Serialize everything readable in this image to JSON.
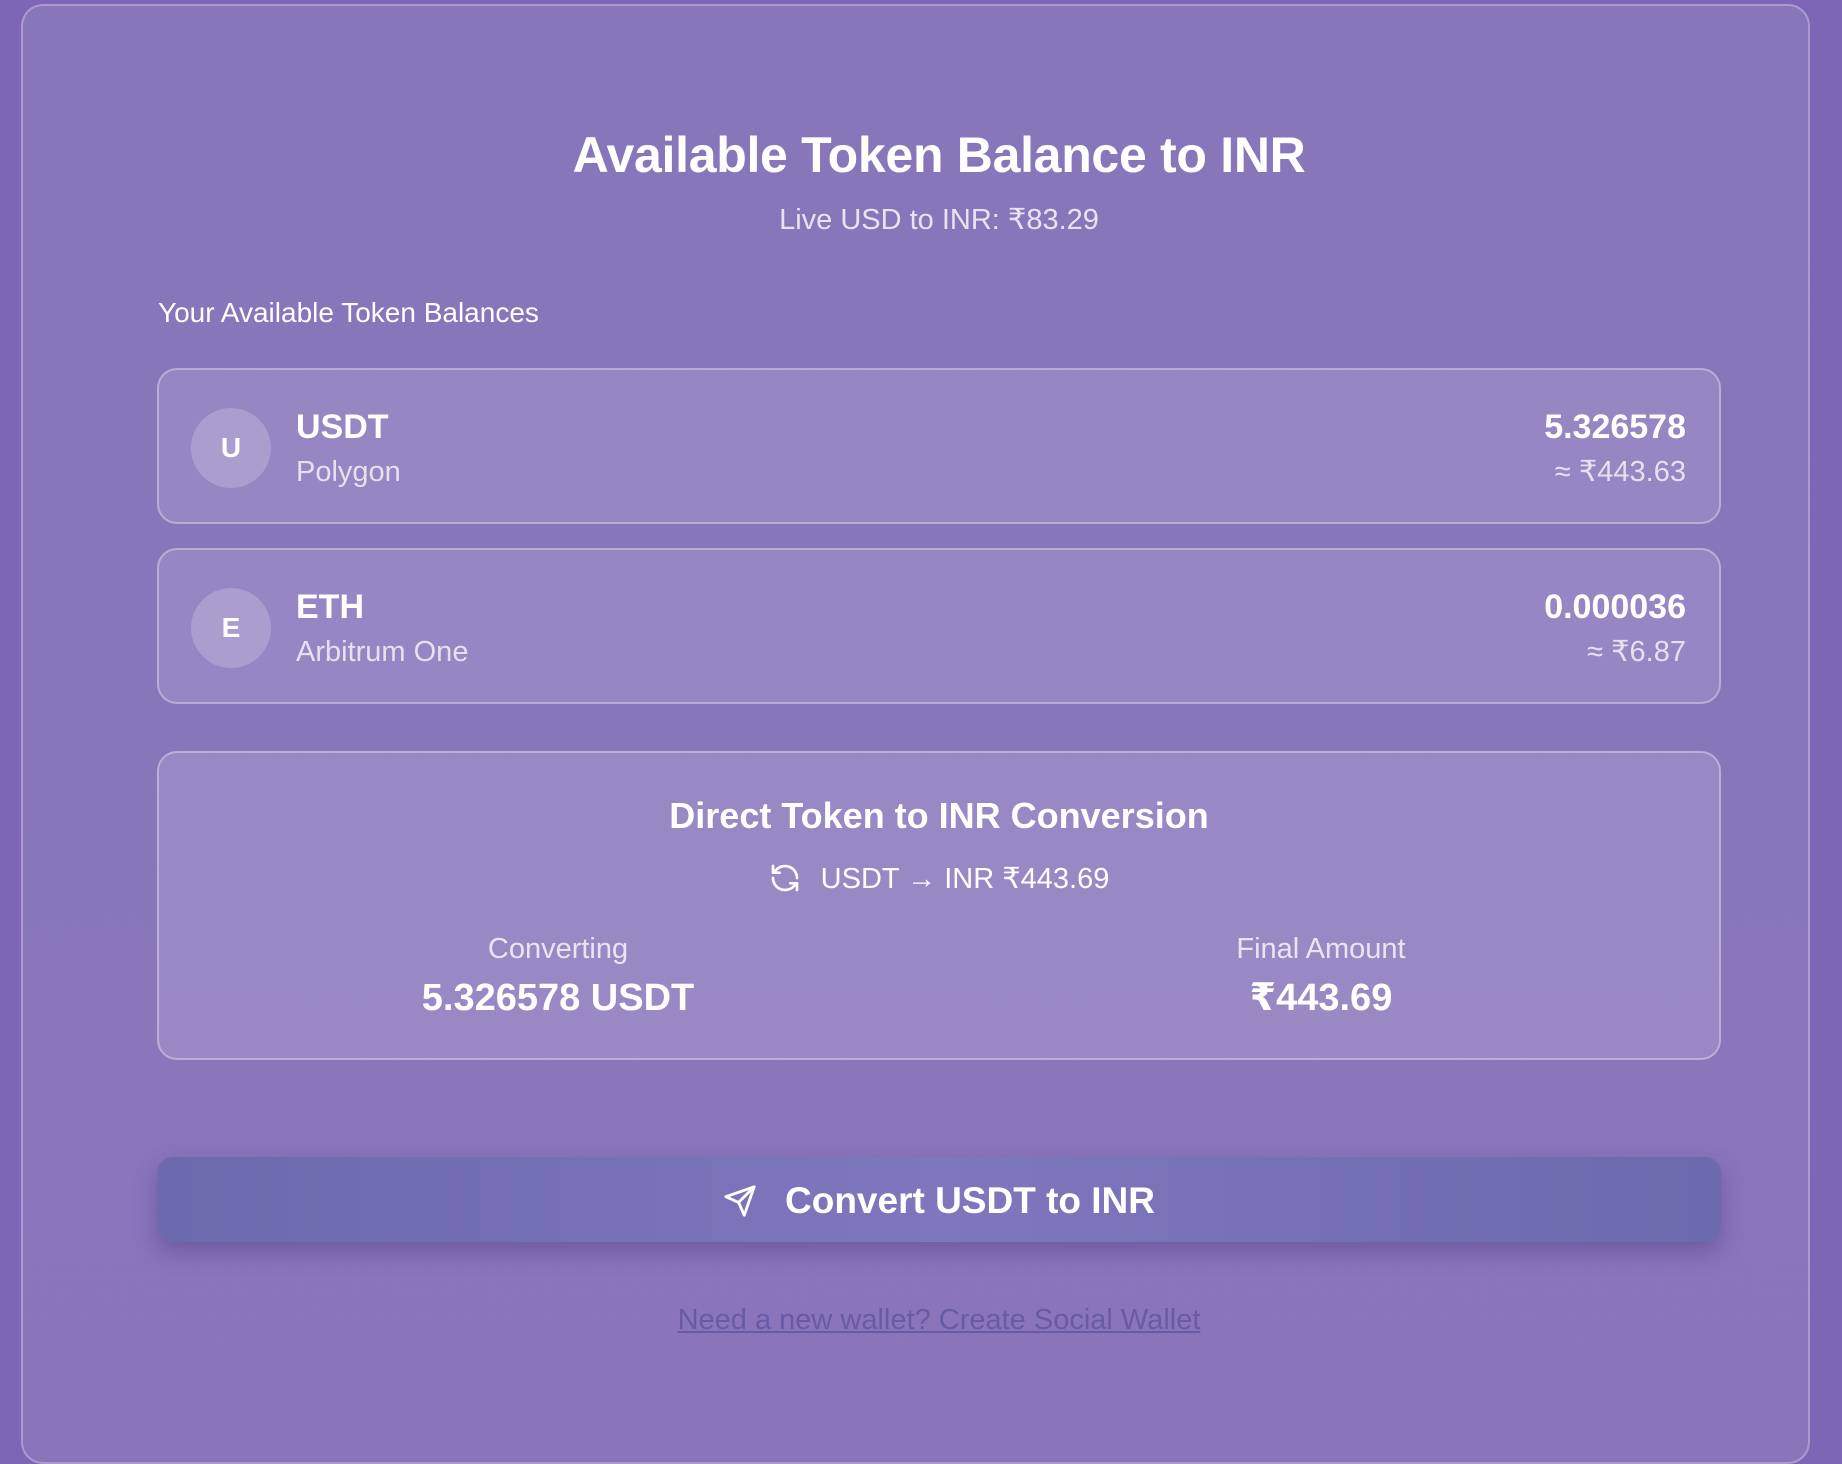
{
  "header": {
    "title": "Available Token Balance to INR",
    "rate_text": "Live USD to INR: ₹83.29"
  },
  "balances": {
    "section_label": "Your Available Token Balances",
    "tokens": [
      {
        "initial": "U",
        "symbol": "USDT",
        "network": "Polygon",
        "amount": "5.326578",
        "inr_value": "≈ ₹443.63"
      },
      {
        "initial": "E",
        "symbol": "ETH",
        "network": "Arbitrum One",
        "amount": "0.000036",
        "inr_value": "≈ ₹6.87"
      }
    ]
  },
  "conversion": {
    "title": "Direct Token to INR Conversion",
    "route": "USDT → INR ₹443.69",
    "route_icon": "refresh-icon",
    "converting_label": "Converting",
    "converting_value": "5.326578 USDT",
    "final_label": "Final Amount",
    "final_value": "₹443.69"
  },
  "actions": {
    "convert_label": "Convert USDT to INR",
    "convert_icon": "send-icon",
    "wallet_link": "Need a new wallet? Create Social Wallet"
  },
  "colors": {
    "background": "#7d66b6",
    "panel": "#8776ba",
    "button": "#7e77bd",
    "link": "#675ba5"
  }
}
